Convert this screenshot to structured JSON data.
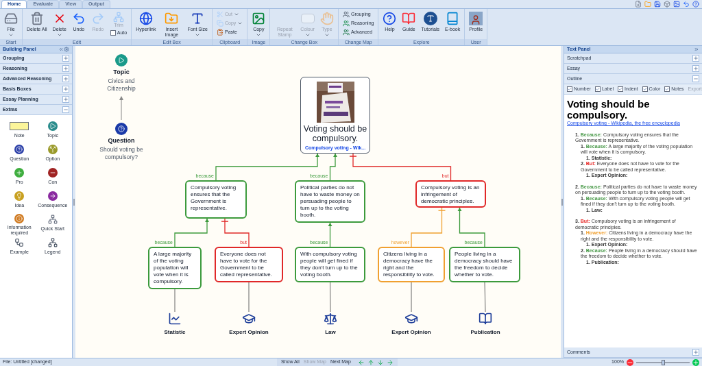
{
  "tabs": [
    {
      "label": "Home",
      "selected": true
    },
    {
      "label": "Evaluate",
      "selected": false
    },
    {
      "label": "View",
      "selected": false
    },
    {
      "label": "Output",
      "selected": false
    }
  ],
  "ribbon": {
    "groups": [
      {
        "label": "Start",
        "items": [
          {
            "kind": "large",
            "label": "File",
            "dropdown": true,
            "disabled": false
          }
        ]
      },
      {
        "label": "Edit",
        "items": [
          {
            "kind": "large",
            "label": "Delete All",
            "dropdown": false,
            "disabled": false
          },
          {
            "kind": "large",
            "label": "Delete",
            "dropdown": true,
            "disabled": false
          },
          {
            "kind": "large",
            "label": "Undo",
            "dropdown": false,
            "disabled": false
          },
          {
            "kind": "large",
            "label": "Redo",
            "dropdown": false,
            "disabled": true
          },
          {
            "kind": "stack",
            "items": [
              {
                "kind": "large",
                "label": "Trim",
                "dropdown": false,
                "disabled": true
              },
              {
                "kind": "checkbox",
                "label": "Auto",
                "checked": false
              }
            ]
          }
        ]
      },
      {
        "label": "Edit Box",
        "items": [
          {
            "kind": "large",
            "label": "Hyperlink",
            "dropdown": false,
            "disabled": false
          },
          {
            "kind": "large",
            "label": "Insert Image",
            "dropdown": false,
            "disabled": false
          },
          {
            "kind": "large",
            "label": "Font Size",
            "dropdown": true,
            "disabled": false
          }
        ]
      },
      {
        "label": "Clipboard",
        "items": [
          {
            "kind": "stack",
            "items": [
              {
                "kind": "small",
                "label": "Cut",
                "dropdown": true,
                "disabled": true
              },
              {
                "kind": "small",
                "label": "Copy",
                "dropdown": true,
                "disabled": true
              },
              {
                "kind": "small",
                "label": "Paste",
                "dropdown": false,
                "disabled": false
              }
            ]
          }
        ]
      },
      {
        "label": "Image",
        "items": [
          {
            "kind": "large",
            "label": "Copy",
            "dropdown": true,
            "disabled": false
          }
        ]
      },
      {
        "label": "Change Box",
        "items": [
          {
            "kind": "large",
            "label": "Repeat Stamp",
            "dropdown": false,
            "disabled": true
          },
          {
            "kind": "large",
            "label": "Colour",
            "dropdown": true,
            "disabled": true
          },
          {
            "kind": "large",
            "label": "Type",
            "dropdown": true,
            "disabled": true
          }
        ]
      },
      {
        "label": "Change Map",
        "items": [
          {
            "kind": "stack",
            "items": [
              {
                "kind": "small",
                "label": "Grouping",
                "dropdown": false,
                "disabled": false
              },
              {
                "kind": "small",
                "label": "Reasoning",
                "dropdown": false,
                "disabled": false
              },
              {
                "kind": "small",
                "label": "Advanced",
                "dropdown": false,
                "disabled": false
              }
            ]
          }
        ]
      },
      {
        "label": "Explore",
        "items": [
          {
            "kind": "large",
            "label": "Help",
            "dropdown": false,
            "disabled": false
          },
          {
            "kind": "large",
            "label": "Guide",
            "dropdown": false,
            "disabled": false
          },
          {
            "kind": "large",
            "label": "Tutorials",
            "dropdown": false,
            "disabled": false
          },
          {
            "kind": "large",
            "label": "E-book",
            "dropdown": false,
            "disabled": false
          }
        ]
      },
      {
        "label": "User",
        "items": [
          {
            "kind": "large",
            "label": "Profile",
            "dropdown": false,
            "disabled": false
          }
        ]
      }
    ]
  },
  "building_panel": {
    "title": "Building Panel",
    "sections": [
      {
        "label": "Grouping",
        "expanded": false
      },
      {
        "label": "Reasoning",
        "expanded": false
      },
      {
        "label": "Advanced Reasoning",
        "expanded": false
      },
      {
        "label": "Basis Boxes",
        "expanded": false
      },
      {
        "label": "Essay Planning",
        "expanded": false
      },
      {
        "label": "Extras",
        "expanded": true,
        "items": [
          {
            "label": "Note"
          },
          {
            "label": "Topic"
          },
          {
            "label": "Question"
          },
          {
            "label": "Option"
          },
          {
            "label": "Pro"
          },
          {
            "label": "Con"
          },
          {
            "label": "Idea"
          },
          {
            "label": "Consequence"
          },
          {
            "label": "Information required"
          },
          {
            "label": "Quick Start"
          },
          {
            "label": "Example"
          },
          {
            "label": "Legend"
          }
        ]
      }
    ]
  },
  "map": {
    "topic": {
      "heading": "Topic",
      "text": "Civics and Citizenship"
    },
    "question": {
      "heading": "Question",
      "text": "Should voting be compulsory?"
    },
    "contention": {
      "text": "Voting should be compulsory.",
      "link": "Compulsory voting - Wik..."
    },
    "reasons": [
      {
        "kind": "reason",
        "label": "because",
        "color": "#3c9a3c",
        "text": "Compulsory voting ensures that the Government is representative.",
        "children": [
          {
            "kind": "reason",
            "label": "because",
            "color": "#3c9a3c",
            "text": "A large majority of the voting population will vote when it is compulsory.",
            "children": [
              {
                "kind": "basis",
                "text": "Statistic"
              }
            ]
          },
          {
            "kind": "objection",
            "label": "but",
            "color": "#e02828",
            "text": "Everyone does not have to vote for the Government to be called representative.",
            "children": [
              {
                "kind": "basis",
                "text": "Expert Opinion"
              }
            ]
          }
        ]
      },
      {
        "kind": "reason",
        "label": "because",
        "color": "#3c9a3c",
        "text": "Political parties do not have to waste money on persuading people to turn up to the voting booth.",
        "children": [
          {
            "kind": "reason",
            "label": "because",
            "color": "#3c9a3c",
            "text": "With compulsory voting people will get fined if they don't turn up to the voting booth.",
            "children": [
              {
                "kind": "basis",
                "text": "Law"
              }
            ]
          }
        ]
      },
      {
        "kind": "objection",
        "label": "but",
        "color": "#e02828",
        "text": "Compulsory voting is an infringement of democratic principles.",
        "children": [
          {
            "kind": "objection",
            "label": "however",
            "color": "#f0a030",
            "text": "Citizens living in a democracy have the right and the responsibility to vote.",
            "children": [
              {
                "kind": "basis",
                "text": "Expert Opinion"
              }
            ]
          },
          {
            "kind": "reason",
            "label": "because",
            "color": "#3c9a3c",
            "text": "People living in a democracy should have the freedom to decide whether to vote.",
            "children": [
              {
                "kind": "basis",
                "text": "Publication"
              }
            ]
          }
        ]
      }
    ]
  },
  "text_panel": {
    "title": "Text Panel",
    "sections": [
      {
        "label": "Scratchpad",
        "expanded": false
      },
      {
        "label": "Essay",
        "expanded": false
      },
      {
        "label": "Outline",
        "expanded": true,
        "options": [
          {
            "label": "Number",
            "checked": true
          },
          {
            "label": "Label",
            "checked": true
          },
          {
            "label": "Indent",
            "checked": true
          },
          {
            "label": "Color",
            "checked": true
          },
          {
            "label": "Notes",
            "checked": true
          }
        ],
        "export": {
          "label": "Export",
          "disabled": true
        },
        "outline": {
          "title": "Voting should be compulsory.",
          "link": "Compulsory voting - Wikipedia, the free encyclopedia",
          "items": [
            {
              "kind": "reason",
              "number": "1.",
              "label": "Because:",
              "color": "#4a9a4a",
              "text": "Compulsory voting ensures that the Government is representative.",
              "children": [
                {
                  "kind": "reason",
                  "number": "1.",
                  "label": "Because:",
                  "color": "#4a9a4a",
                  "text": "A large majority of the voting population will vote when it is compulsory.",
                  "children": [
                    {
                      "kind": "basis",
                      "number": "1.",
                      "label": "Statistic:"
                    }
                  ]
                },
                {
                  "kind": "reason",
                  "number": "2.",
                  "label": "But:",
                  "color": "#e8302e",
                  "text": "Everyone does not have to vote for the Government to be called representative.",
                  "children": [
                    {
                      "kind": "basis",
                      "number": "1.",
                      "label": "Expert Opinion:"
                    }
                  ]
                }
              ]
            },
            {
              "kind": "reason",
              "number": "2.",
              "label": "Because:",
              "color": "#4a9a4a",
              "text": "Political parties do not have to waste money on persuading people to turn up to the voting booth.",
              "children": [
                {
                  "kind": "reason",
                  "number": "1.",
                  "label": "Because:",
                  "color": "#4a9a4a",
                  "text": "With compulsory voting people will get fined if they don't turn up to the voting booth.",
                  "children": [
                    {
                      "kind": "basis",
                      "number": "1.",
                      "label": "Law:"
                    }
                  ]
                }
              ]
            },
            {
              "kind": "reason",
              "number": "3.",
              "label": "But:",
              "color": "#e8302e",
              "text": "Compulsory voting is an infringement of democratic principles.",
              "children": [
                {
                  "kind": "reason",
                  "number": "1.",
                  "label": "However:",
                  "color": "#f0a030",
                  "text": "Citizens living in a democracy have the right and the responsibility to vote.",
                  "children": [
                    {
                      "kind": "basis",
                      "number": "1.",
                      "label": "Expert Opinion:"
                    }
                  ]
                },
                {
                  "kind": "reason",
                  "number": "2.",
                  "label": "Because:",
                  "color": "#4a9a4a",
                  "text": "People living in a democracy should have the freedom to decide whether to vote.",
                  "children": [
                    {
                      "kind": "basis",
                      "number": "1.",
                      "label": "Publication:"
                    }
                  ]
                }
              ]
            }
          ]
        }
      }
    ],
    "comments": {
      "label": "Comments",
      "expanded": false
    }
  },
  "status_bar": {
    "file": "File: Untitled [changed]",
    "buttons": [
      {
        "label": "Show All",
        "disabled": false
      },
      {
        "label": "Show Map",
        "disabled": true
      },
      {
        "label": "Next Map",
        "disabled": false
      }
    ],
    "zoom": {
      "reading": "100%",
      "level": 0.5
    }
  }
}
